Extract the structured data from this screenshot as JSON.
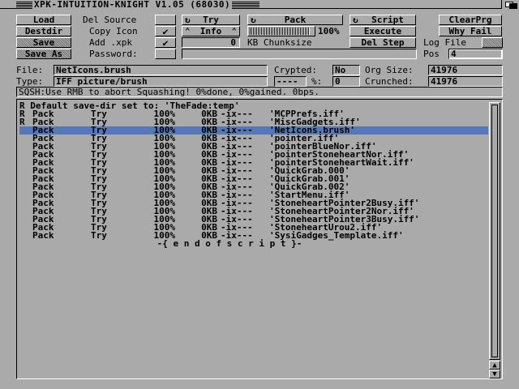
{
  "window": {
    "title": "XPK-INTUITION-KNIGHT V1.05 (68030)"
  },
  "buttons": {
    "load": "Load",
    "destdir": "Destdir",
    "save": "Save",
    "save_as": "Save As",
    "try": "Try",
    "pack": "Pack",
    "script": "Script",
    "clearprg": "ClearPrg",
    "info": "Info",
    "execute": "Execute",
    "why_fail": "Why Fail",
    "del_step": "Del Step"
  },
  "options": {
    "del_source": {
      "label": "Del Source",
      "checked": false
    },
    "copy_icon": {
      "label": "Copy Icon",
      "checked": true
    },
    "add_xpk": {
      "label": "Add .xpk",
      "checked": true
    },
    "password": {
      "label": "Password:"
    },
    "log_file": {
      "label": "Log File"
    },
    "pos_label": "Pos",
    "pos_value": "4"
  },
  "chunksize": {
    "percent_label": "100%",
    "value": "0",
    "unit": "KB Chunksize",
    "fill_percent": 100
  },
  "fileinfo": {
    "file_label": "File:",
    "file_value": "NetIcons.brush",
    "type_label": "Type:",
    "type_value": "IFF picture/brush",
    "crypted_label": "Crypted:",
    "crypted_value": "No",
    "org_label": "Org Size:",
    "org_value": "41976",
    "ratio_value": "----",
    "pct_label": "%:",
    "pct_value": "0",
    "crunched_label": "Crunched:",
    "crunched_value": "41976"
  },
  "status": "SQSH:Use RMB to abort Squashing! 0%done, 0%gained. 0bps.",
  "log": {
    "header": "R Default save-dir set to: 'TheFade:temp'",
    "rows": [
      {
        "flag": "R",
        "action": "Pack",
        "mode": "Try",
        "pct": "100%",
        "kb": "0KB",
        "attr": "-ix---",
        "file": "'MCPPrefs.iff'",
        "selected": false
      },
      {
        "flag": "R",
        "action": "Pack",
        "mode": "Try",
        "pct": "100%",
        "kb": "0KB",
        "attr": "-ix---",
        "file": "'MiscGadgets.iff'",
        "selected": false
      },
      {
        "flag": "",
        "action": "Pack",
        "mode": "Try",
        "pct": "100%",
        "kb": "0KB",
        "attr": "-ix---",
        "file": "'NetIcons.brush'",
        "selected": true
      },
      {
        "flag": "",
        "action": "Pack",
        "mode": "Try",
        "pct": "100%",
        "kb": "0KB",
        "attr": "-ix---",
        "file": "'pointer.iff'",
        "selected": false
      },
      {
        "flag": "",
        "action": "Pack",
        "mode": "Try",
        "pct": "100%",
        "kb": "0KB",
        "attr": "-ix---",
        "file": "'pointerBlueNor.iff'",
        "selected": false
      },
      {
        "flag": "",
        "action": "Pack",
        "mode": "Try",
        "pct": "100%",
        "kb": "0KB",
        "attr": "-ix---",
        "file": "'pointerStoneheartNor.iff'",
        "selected": false
      },
      {
        "flag": "",
        "action": "Pack",
        "mode": "Try",
        "pct": "100%",
        "kb": "0KB",
        "attr": "-ix---",
        "file": "'pointerStoneheartWait.iff'",
        "selected": false
      },
      {
        "flag": "",
        "action": "Pack",
        "mode": "Try",
        "pct": "100%",
        "kb": "0KB",
        "attr": "-ix---",
        "file": "'QuickGrab.000'",
        "selected": false
      },
      {
        "flag": "",
        "action": "Pack",
        "mode": "Try",
        "pct": "100%",
        "kb": "0KB",
        "attr": "-ix---",
        "file": "'QuickGrab.001'",
        "selected": false
      },
      {
        "flag": "",
        "action": "Pack",
        "mode": "Try",
        "pct": "100%",
        "kb": "0KB",
        "attr": "-ix---",
        "file": "'QuickGrab.002'",
        "selected": false
      },
      {
        "flag": "",
        "action": "Pack",
        "mode": "Try",
        "pct": "100%",
        "kb": "0KB",
        "attr": "-ix---",
        "file": "'StartMenu.iff'",
        "selected": false
      },
      {
        "flag": "",
        "action": "Pack",
        "mode": "Try",
        "pct": "100%",
        "kb": "0KB",
        "attr": "-ix---",
        "file": "'StoneheartPointer2Busy.iff'",
        "selected": false
      },
      {
        "flag": "",
        "action": "Pack",
        "mode": "Try",
        "pct": "100%",
        "kb": "0KB",
        "attr": "-ix---",
        "file": "'StoneheartPointer2Nor.iff'",
        "selected": false
      },
      {
        "flag": "",
        "action": "Pack",
        "mode": "Try",
        "pct": "100%",
        "kb": "0KB",
        "attr": "-ix---",
        "file": "'StoneheartPointer3Busy.iff'",
        "selected": false
      },
      {
        "flag": "",
        "action": "Pack",
        "mode": "Try",
        "pct": "100%",
        "kb": "0KB",
        "attr": "-ix---",
        "file": "'StoneheartUrou2.iff'",
        "selected": false
      },
      {
        "flag": "",
        "action": "Pack",
        "mode": "Try",
        "pct": "100%",
        "kb": "0KB",
        "attr": "-ix---",
        "file": "'SysiGadges_Template.iff'",
        "selected": false
      }
    ],
    "end": "-{ e n d   o f   s c r i p t }-"
  },
  "icons": {
    "check": "✔",
    "cycle": "↻",
    "up": "⌃",
    "scroll_up": "▲",
    "scroll_down": "▼"
  },
  "colors": {
    "background": "#aaaaaa",
    "selection": "#5577bb"
  }
}
